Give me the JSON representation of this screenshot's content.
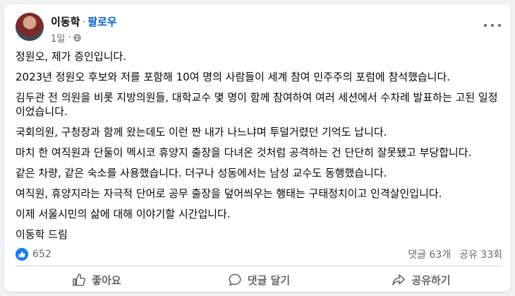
{
  "post": {
    "author": "이동학",
    "separator": "·",
    "follow_label": "팔로우",
    "time": "1일",
    "meta_separator": "·",
    "privacy_icon": "globe-icon",
    "more_icon": "more-options-icon",
    "paragraphs": [
      "정원오, 제가 증인입니다.",
      "2023년 정원오 후보와 저를 포함해 10여 명의 사람들이 세계 참여 민주주의 포럼에 참석했습니다.",
      "김두관 전 의원을 비롯 지방의원들, 대학교수 몇 명이 함께 참여하여 여러 세션에서 수차례 발표하는 고된 일정이었습니다.",
      "국회의원, 구청장과 함께 왔는데도 이런 짠 내가 나느냐며 투덜거렸던 기억도 납니다.",
      "마치 한 여직원과 단둘이 멕시코 휴양지 출장을 다녀온 것처럼 공격하는 건 단단히 잘못됐고 부당합니다.",
      "같은 차량, 같은 숙소를 사용했습니다. 더구나 성동에서는 남성 교수도 동행했습니다.",
      "여직원, 휴양지라는 자극적 단어로 공무 출장을 덮어씌우는 행태는 구태정치이고 인격살인입니다.",
      "이제 서울시민의 삶에 대해 이야기할 시간입니다.",
      "이동학 드림"
    ]
  },
  "stats": {
    "reaction_icon": "like-badge-icon",
    "reactions": "652",
    "comments": "댓글 63개",
    "shares": "공유 33회"
  },
  "actions": {
    "like_label": "좋아요",
    "comment_label": "댓글 달기",
    "share_label": "공유하기"
  },
  "colors": {
    "accent": "#1877f2",
    "follow": "#0064d1",
    "secondary_text": "#65676b",
    "background": "#f0f2f5"
  }
}
